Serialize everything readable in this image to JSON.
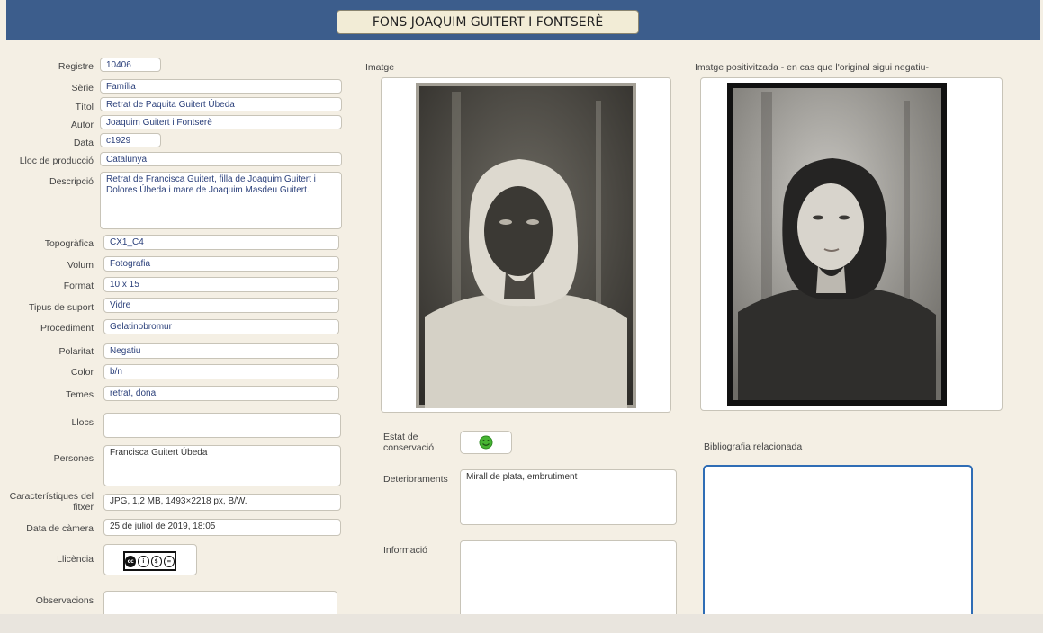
{
  "header": {
    "title": "FONS JOAQUIM GUITERT I FONTSERÈ"
  },
  "fields": [
    {
      "label": "Registre",
      "value": "10406"
    },
    {
      "label": "Sèrie",
      "value": "Família"
    },
    {
      "label": "Títol",
      "value": "Retrat de Paquita Guitert Úbeda"
    },
    {
      "label": "Autor",
      "value": "Joaquim Guitert i Fontserè"
    },
    {
      "label": "Data",
      "value": "c1929"
    },
    {
      "label": "Lloc de producció",
      "value": "Catalunya"
    },
    {
      "label": "Descripció",
      "value": "Retrat de Francisca Guitert, filla de Joaquim Guitert i Dolores Úbeda i mare de Joaquim Masdeu Guitert."
    },
    {
      "label": "Topogràfica",
      "value": "CX1_C4"
    },
    {
      "label": "Volum",
      "value": "Fotografia"
    },
    {
      "label": "Format",
      "value": "10 x 15"
    },
    {
      "label": "Tipus de suport",
      "value": "Vidre"
    },
    {
      "label": "Procediment",
      "value": "Gelatinobromur"
    },
    {
      "label": "Polaritat",
      "value": "Negatiu"
    },
    {
      "label": "Color",
      "value": "b/n"
    },
    {
      "label": "Temes",
      "value": "retrat, dona"
    },
    {
      "label": "Llocs",
      "value": ""
    },
    {
      "label": "Persones",
      "value": "Francisca Guitert Úbeda"
    },
    {
      "label": "Característiques del fitxer",
      "value": "JPG, 1,2 MB, 1493×2218 px, B/W."
    },
    {
      "label": "Data de càmera",
      "value": "25 de juliol de 2019, 18:05"
    },
    {
      "label": "Llicència",
      "value": ""
    },
    {
      "label": "Observacions",
      "value": ""
    }
  ],
  "license": {
    "badge": "cc",
    "icons": [
      "cc-icon",
      "by-icon",
      "nc-icon",
      "nd-icon"
    ]
  },
  "image_section": {
    "label": "Imatge",
    "positive_label": "Imatge positivitzada - en cas que l'original sigui negatiu-"
  },
  "conservation": {
    "label": "Estat de conservació",
    "status_icon": "smiley-icon",
    "status_color": "#46b432"
  },
  "deterioraments": {
    "label": "Deterioraments",
    "value": "Mirall de plata, embrutiment"
  },
  "informacio": {
    "label": "Informació",
    "value": ""
  },
  "bibliografia": {
    "label": "Bibliografia relacionada",
    "value": ""
  },
  "colors": {
    "header": "#3c5d8c",
    "background": "#f4efe4",
    "field_text": "#2a3f7a",
    "focus_border": "#2f6db5"
  }
}
